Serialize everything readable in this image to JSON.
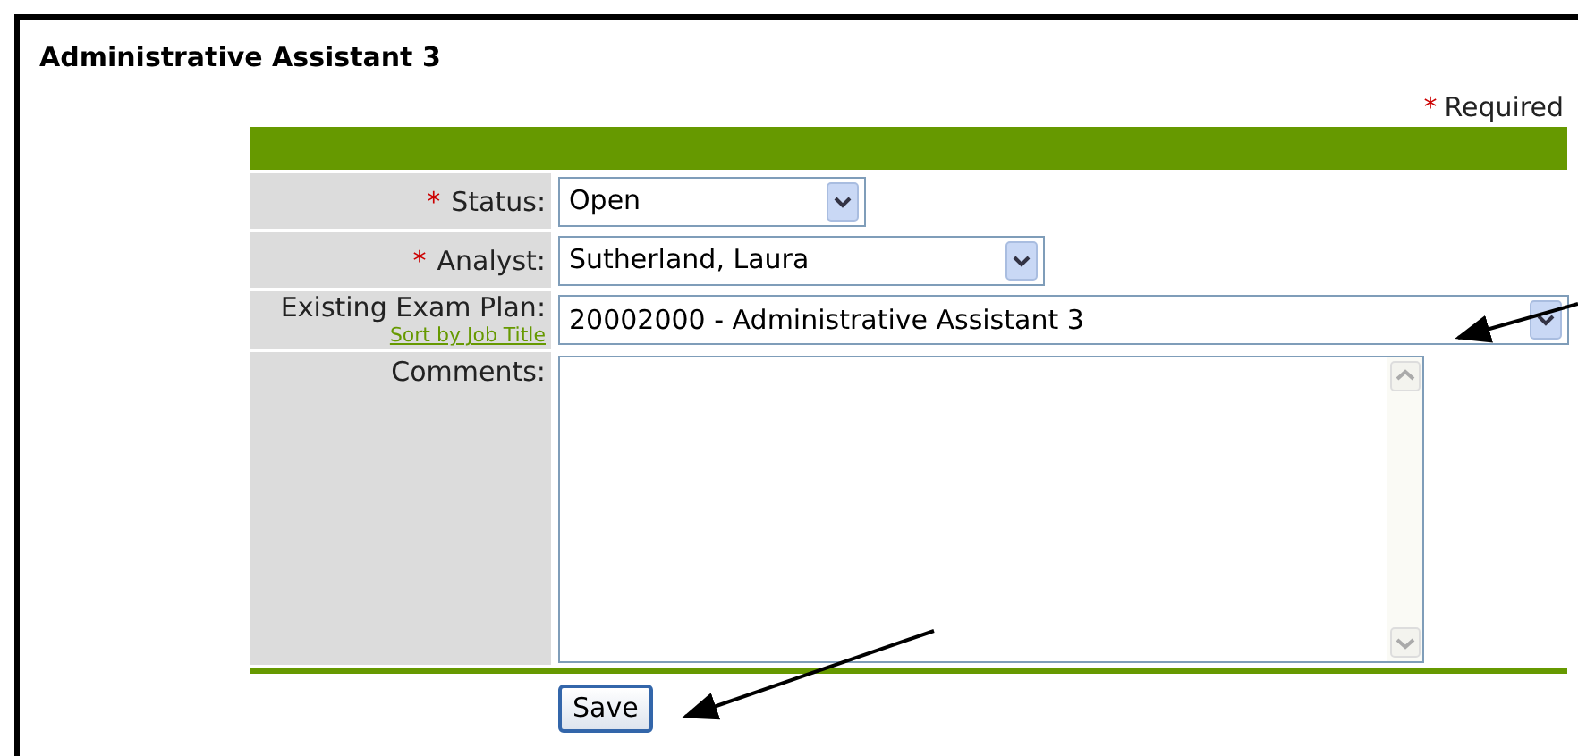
{
  "title": "Administrative Assistant 3",
  "required_note": {
    "marker": "*",
    "text": "Required"
  },
  "fields": [
    {
      "kind": "select",
      "marker": "*",
      "label": "Status:",
      "value": "Open"
    },
    {
      "kind": "select",
      "marker": "*",
      "label": "Analyst:",
      "value": "Sutherland, Laura"
    },
    {
      "kind": "select",
      "label": "Existing Exam Plan:",
      "link": "Sort by Job Title",
      "value": "20002000 - Administrative Assistant 3"
    },
    {
      "kind": "textarea",
      "label": "Comments:"
    }
  ],
  "save_button": "Save"
}
